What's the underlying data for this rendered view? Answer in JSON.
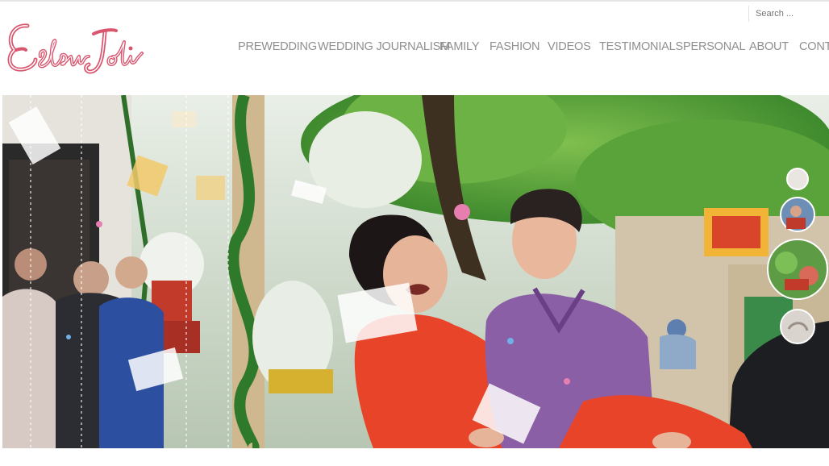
{
  "search": {
    "placeholder": "Search ..."
  },
  "logo": {
    "text": "EclairJoli",
    "color": "#d9566f"
  },
  "nav": {
    "items": [
      {
        "label": "PREWEDDING"
      },
      {
        "label": "WEDDING JOURNALISM"
      },
      {
        "label": "FAMILY"
      },
      {
        "label": "FASHION"
      },
      {
        "label": "VIDEOS"
      },
      {
        "label": "TESTIMONIALS"
      },
      {
        "label": "PERSONAL"
      },
      {
        "label": "ABOUT"
      },
      {
        "label": "CONTA"
      }
    ]
  },
  "hero": {
    "thumbnails": [
      {
        "icon": "street-thumbnail-icon"
      },
      {
        "icon": "couple-thumbnail-icon"
      },
      {
        "icon": "tree-thumbnail-icon"
      },
      {
        "icon": "dot-thumbnail-icon"
      }
    ]
  },
  "colors": {
    "accent": "#d9566f",
    "nav_text": "#8f8f8f",
    "dress_red": "#e8442a",
    "shirt_purple": "#8b5fa6"
  }
}
